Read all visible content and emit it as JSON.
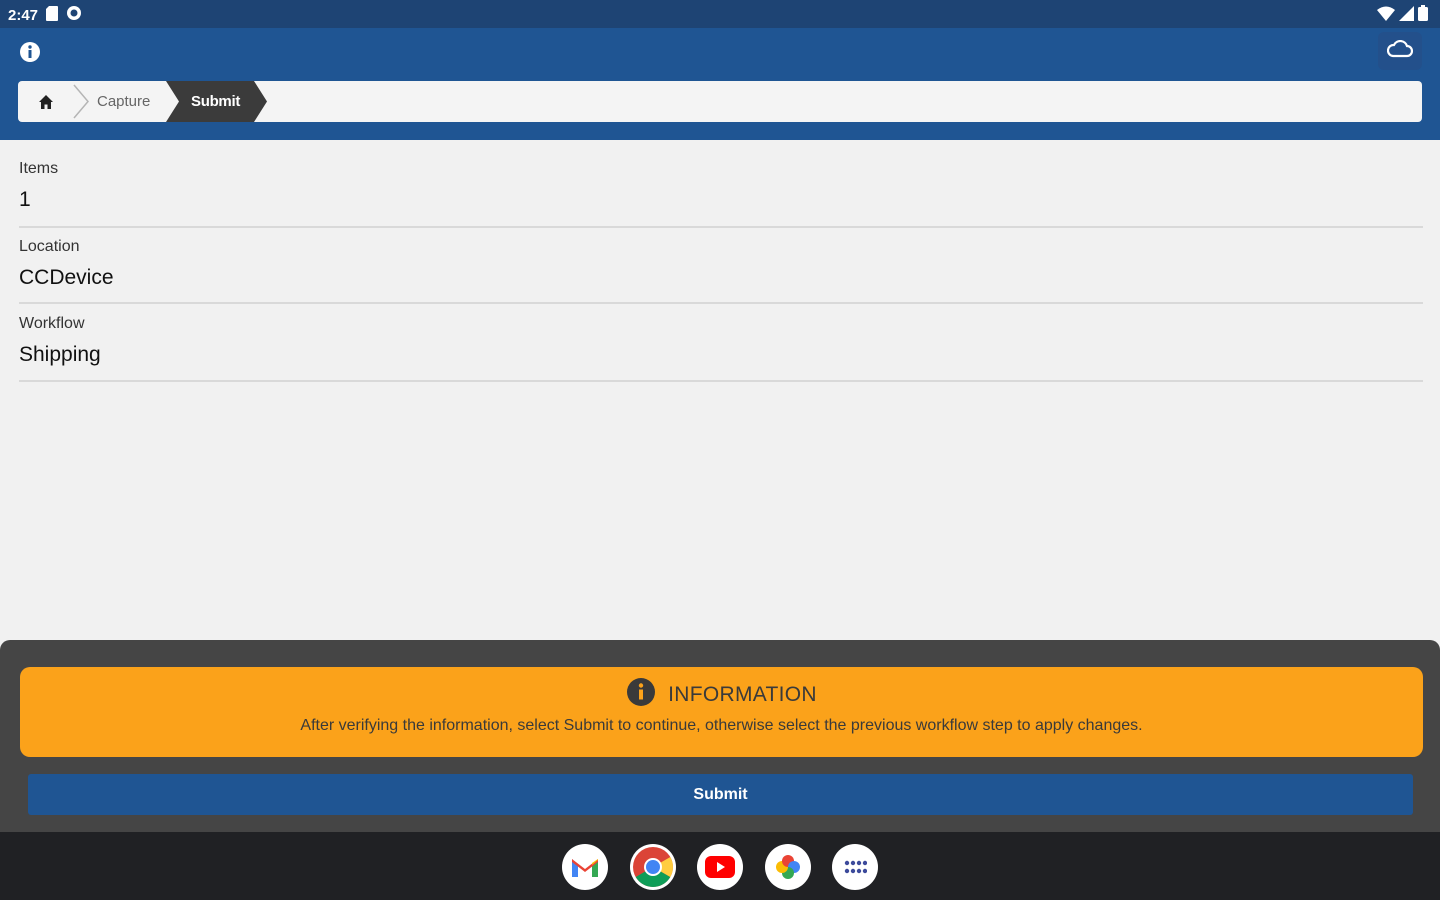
{
  "status_bar": {
    "time": "2:47"
  },
  "breadcrumb": {
    "steps": [
      "Capture",
      "Submit"
    ]
  },
  "fields": [
    {
      "label": "Items",
      "value": "1"
    },
    {
      "label": "Location",
      "value": "CCDevice"
    },
    {
      "label": "Workflow",
      "value": "Shipping"
    }
  ],
  "info_card": {
    "title": "INFORMATION",
    "message": "After verifying the information, select Submit to continue, otherwise select the previous workflow step to apply changes."
  },
  "actions": {
    "submit_label": "Submit"
  },
  "dock": {
    "apps": [
      "gmail-icon",
      "chrome-icon",
      "youtube-icon",
      "photos-icon",
      "app-drawer-icon"
    ]
  },
  "colors": {
    "app_bar": "#1f5593",
    "status_bar": "#1e4474",
    "info_card": "#fba21a",
    "panel": "#454545",
    "nav_bar": "#202124",
    "breadcrumb_active": "#3b3b3b"
  }
}
